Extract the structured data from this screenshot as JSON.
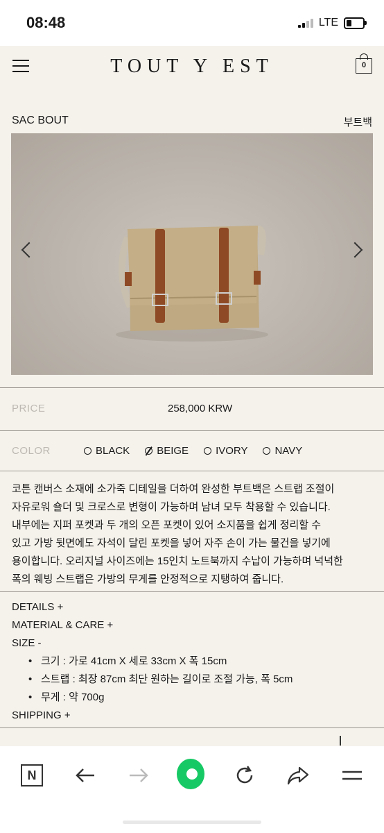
{
  "status": {
    "time": "08:48",
    "network": "LTE"
  },
  "brand": "TOUT Y EST",
  "cart_count": "0",
  "product": {
    "name": "SAC BOUT",
    "name_ko": "부트백",
    "price_label": "PRICE",
    "price": "258,000 KRW",
    "color_label": "COLOR",
    "colors": [
      "BLACK",
      "BEIGE",
      "IVORY",
      "NAVY"
    ],
    "selected_color": "BEIGE",
    "description": [
      "코튼 캔버스 소재에 소가죽 디테일을 더하여 완성한 부트백은 스트랩 조절이",
      "자유로워 숄더 및 크로스로 변형이 가능하며 남녀 모두 착용할 수 있습니다.",
      "내부에는 지퍼 포켓과 두 개의 오픈 포켓이 있어 소지품을 쉽게 정리할 수",
      "있고 가방 뒷면에도 자석이 달린 포켓을 넣어 자주 손이 가는 물건을 넣기에",
      "용이합니다. 오리지널 사이즈에는 15인치 노트북까지 수납이 가능하며 넉넉한",
      "폭의 웨빙 스트랩은 가방의 무게를 안정적으로 지탱하여 줍니다."
    ],
    "details_label": "DETAILS +",
    "material_label": "MATERIAL & CARE +",
    "size_label": "SIZE -",
    "size_items": [
      "크기 : 가로 41cm X 세로 33cm X 폭 15cm",
      "스트랩 : 최장 87cm 최단 원하는 길이로 조절 가능, 폭 5cm",
      "무게 : 약 700g"
    ],
    "shipping_label": "SHIPPING +"
  },
  "colors": {
    "accent": "#17c964",
    "background": "#f5f2ec"
  },
  "icons": [
    "hamburger-icon",
    "bag-icon",
    "chevron-left-icon",
    "chevron-right-icon",
    "n-icon",
    "back-arrow-icon",
    "forward-arrow-icon",
    "green-dot-icon",
    "refresh-icon",
    "share-icon",
    "menu-icon"
  ]
}
